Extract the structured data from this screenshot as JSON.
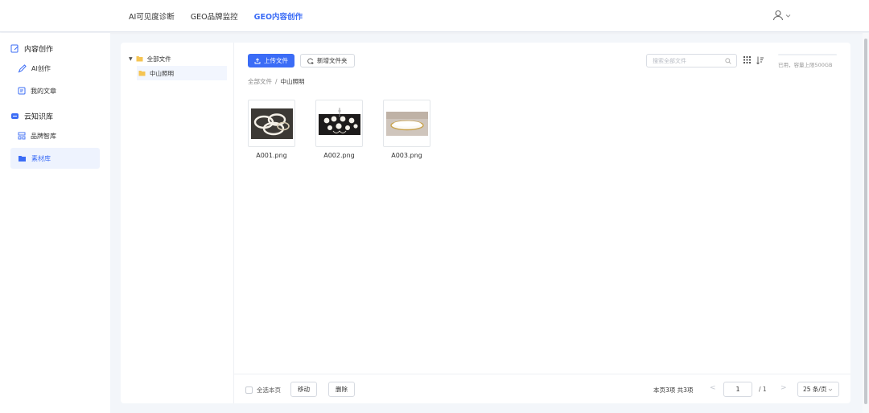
{
  "header": {
    "nav": [
      {
        "label": "AI可见度诊断",
        "active": false
      },
      {
        "label": "GEO品牌监控",
        "active": false
      },
      {
        "label": "GEO内容创作",
        "active": true
      }
    ],
    "user_icon": "user-icon",
    "accent": "#3b6cf6"
  },
  "sidebar": {
    "groups": [
      {
        "label": "内容创作",
        "icon": "edit-doc-icon",
        "items": [
          {
            "label": "AI创作",
            "icon": "pen-icon",
            "active": false
          },
          {
            "label": "我的文章",
            "icon": "article-icon",
            "active": false
          }
        ]
      },
      {
        "label": "云知识库",
        "icon": "cloud-box-icon",
        "items": [
          {
            "label": "品牌智库",
            "icon": "grid-library-icon",
            "active": false
          },
          {
            "label": "素材库",
            "icon": "folder-icon",
            "active": true
          }
        ]
      }
    ]
  },
  "tree": {
    "root": "全部文件",
    "children": [
      "中山照明"
    ]
  },
  "toolbar": {
    "upload_label": "上传文件",
    "new_folder_label": "新增文件夹",
    "search_placeholder": "搜索全部文件",
    "storage_text": "已用，容量上限500GB",
    "storage_used_fraction": 0
  },
  "breadcrumb": {
    "root": "全部文件",
    "separator": "/",
    "current": "中山照明"
  },
  "files": [
    {
      "name": "A001.png"
    },
    {
      "name": "A002.png"
    },
    {
      "name": "A003.png"
    }
  ],
  "footer": {
    "select_all_label": "全选本页",
    "move_label": "移动",
    "delete_label": "删除",
    "page_info": "本页3项  共3项",
    "prev": "<",
    "next": ">",
    "current_page": "1",
    "total_pages": "/  1",
    "page_size": "25 条/页"
  }
}
